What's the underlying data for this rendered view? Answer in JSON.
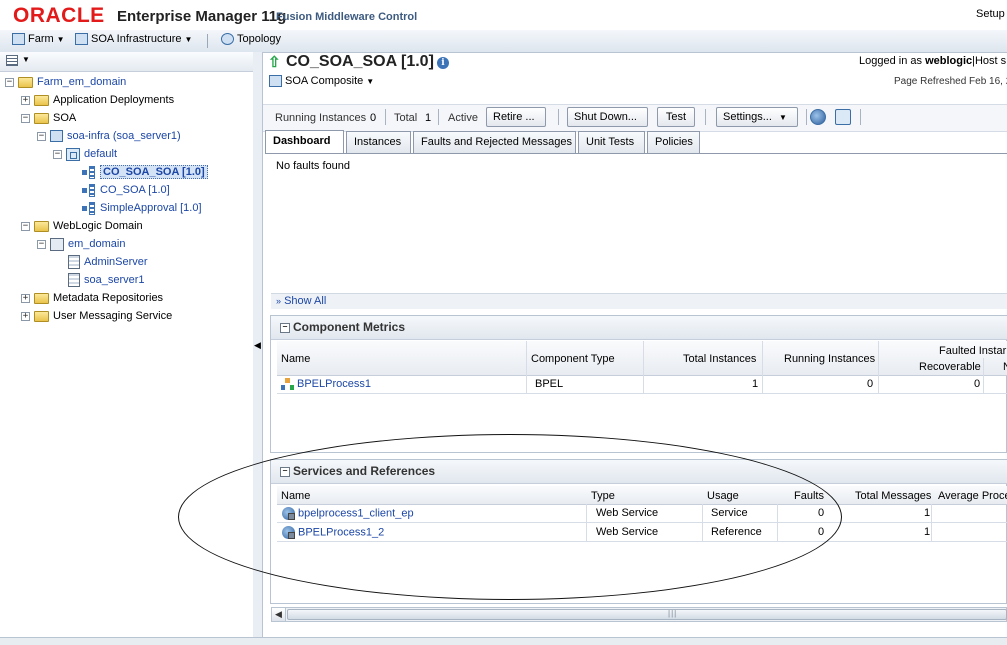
{
  "header": {
    "logo_text": "ORACLE",
    "product_title": "Enterprise Manager 11g",
    "product_subtitle": "Fusion Middleware Control",
    "setup_label": "Setup"
  },
  "menubar": {
    "farm": "Farm",
    "soa_infra": "SOA Infrastructure",
    "topology": "Topology"
  },
  "tree": {
    "farm": "Farm_em_domain",
    "app_deployments": "Application Deployments",
    "soa": "SOA",
    "soa_infra": "soa-infra (soa_server1)",
    "default": "default",
    "co_soa_soa": "CO_SOA_SOA [1.0]",
    "co_soa": "CO_SOA [1.0]",
    "simple_approval": "SimpleApproval [1.0]",
    "weblogic_domain": "WebLogic Domain",
    "em_domain": "em_domain",
    "admin_server": "AdminServer",
    "soa_server1": "soa_server1",
    "metadata_repos": "Metadata Repositories",
    "user_messaging": "User Messaging Service"
  },
  "page": {
    "title": "CO_SOA_SOA [1.0]",
    "composite_menu": "SOA Composite",
    "logged_in_prefix": "Logged in as",
    "logged_in_user": "weblogic",
    "host_label": "|Host s",
    "page_refreshed": "Page Refreshed Feb 16, 2"
  },
  "toolbar": {
    "running_label": "Running Instances",
    "running_value": "0",
    "total_label": "Total",
    "total_value": "1",
    "active_label": "Active",
    "retire_button": "Retire ...",
    "shutdown_button": "Shut Down...",
    "test_button": "Test",
    "settings_button": "Settings..."
  },
  "tabs": {
    "dashboard": "Dashboard",
    "instances": "Instances",
    "faults": "Faults and Rejected Messages",
    "unit_tests": "Unit Tests",
    "policies": "Policies"
  },
  "faults": {
    "message": "No faults found",
    "show_all": "Show All"
  },
  "component_metrics": {
    "title": "Component Metrics",
    "headers": {
      "name": "Name",
      "type": "Component Type",
      "total": "Total Instances",
      "running": "Running Instances",
      "faulted": "Faulted Instar",
      "recoverable": "Recoverable",
      "nonrec": "N"
    },
    "rows": [
      {
        "name": "BPELProcess1",
        "type": "BPEL",
        "total": "1",
        "running": "0",
        "recoverable": "0"
      }
    ]
  },
  "services": {
    "title": "Services and References",
    "headers": {
      "name": "Name",
      "type": "Type",
      "usage": "Usage",
      "faults": "Faults",
      "total": "Total Messages",
      "avg": "Average Proce"
    },
    "rows": [
      {
        "name": "bpelprocess1_client_ep",
        "type": "Web Service",
        "usage": "Service",
        "faults": "0",
        "total": "1"
      },
      {
        "name": "BPELProcess1_2",
        "type": "Web Service",
        "usage": "Reference",
        "faults": "0",
        "total": "1"
      }
    ]
  },
  "colors": {
    "oracle_red": "#e21a1a",
    "link_blue": "#1c47a6",
    "header_blue": "#3d5a80"
  }
}
